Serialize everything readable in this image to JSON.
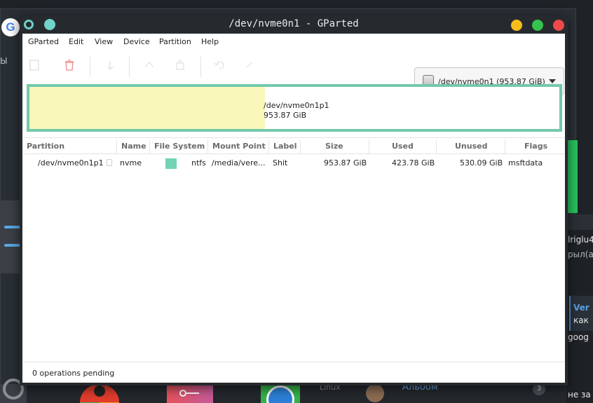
{
  "window": {
    "title": "/dev/nvme0n1 - GParted"
  },
  "menu": [
    "GParted",
    "Edit",
    "View",
    "Device",
    "Partition",
    "Help"
  ],
  "device_selector": {
    "label": "/dev/nvme0n1 (953.87 GiB)"
  },
  "disk_visual": {
    "partition_name": "/dev/nvme0n1p1",
    "partition_size": "953.87 GiB",
    "used_fraction": 0.444,
    "used_color": "#f8f6b8",
    "border_color": "#73c9ad"
  },
  "table": {
    "headers": [
      "Partition",
      "Name",
      "File System",
      "Mount Point",
      "Label",
      "Size",
      "Used",
      "Unused",
      "Flags"
    ],
    "rows": [
      {
        "partition": "/dev/nvme0n1p1",
        "name": "nvme",
        "filesystem": "ntfs",
        "filesystem_color": "#73d3b4",
        "mount_point": "/media/vere...",
        "label": "Shit",
        "size": "953.87 GiB",
        "used": "423.78 GiB",
        "unused": "530.09 GiB",
        "flags": "msftdata"
      }
    ]
  },
  "status": {
    "text": "0 operations pending"
  },
  "background": {
    "left_text": "Ы",
    "chat": {
      "line1": "lriglu4",
      "line2": "рыл(а)",
      "quote_name": "Ver",
      "quote_text": "как",
      "line3": "goog",
      "line4": "не за"
    },
    "taskbar_label_linux": "Linux",
    "taskbar_label_album": "Альбом",
    "taskbar_badge": "3"
  }
}
